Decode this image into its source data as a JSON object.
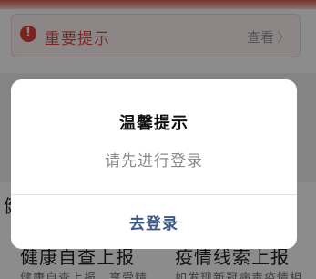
{
  "notice": {
    "title": "重要提示",
    "more_label": "查看",
    "chevron": "〉",
    "icon": "exclamation-icon",
    "accent_color": "#e1423a"
  },
  "background_cards": {
    "peek_char": "健",
    "left": {
      "title": "健康自查上报",
      "subtitle": "健康自查上报，享受精"
    },
    "right": {
      "title": "疫情线索上报",
      "subtitle": "如发现新冠病毒疫情相"
    }
  },
  "dialog": {
    "title": "温馨提示",
    "message": "请先进行登录",
    "button_label": "去登录",
    "button_color": "#3c5a86"
  }
}
